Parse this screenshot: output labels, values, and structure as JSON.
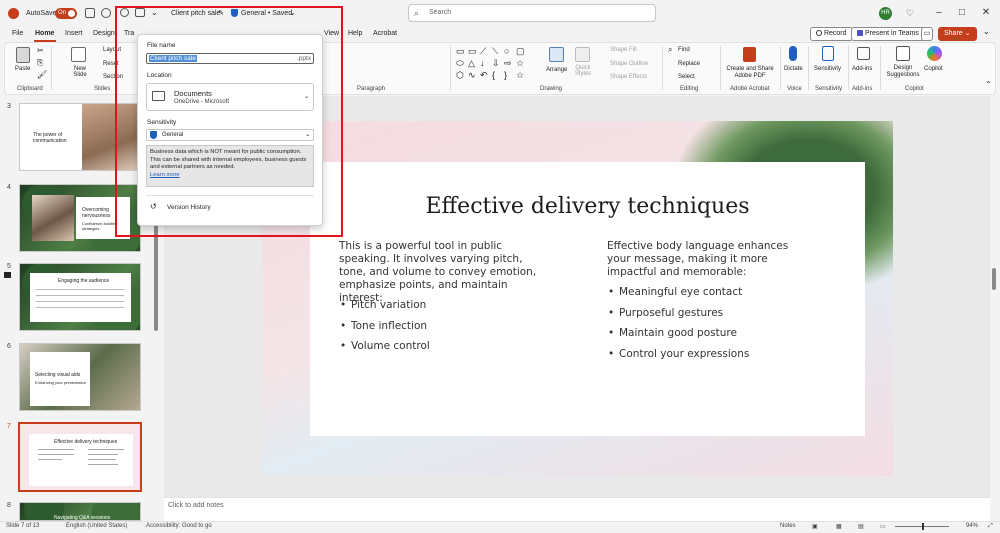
{
  "titlebar": {
    "autosave_label": "AutoSave",
    "autosave_state": "On",
    "doc_title": "Client pitch sale",
    "sensitivity": "General • Saved",
    "search_placeholder": "Search",
    "avatar_initials": "HR"
  },
  "menu": {
    "items": [
      "File",
      "Home",
      "Insert",
      "Design",
      "Tra",
      "View",
      "Help",
      "Acrobat"
    ],
    "record": "Record",
    "present_teams": "Present in Teams",
    "share": "Share"
  },
  "ribbon": {
    "paste": "Paste",
    "new_slide": "New Slide",
    "layout": "Layout",
    "reset": "Reset",
    "section": "Section",
    "arrange": "Arrange",
    "quick_styles": "Quick Styles",
    "shape_fill": "Shape Fill",
    "shape_outline": "Shape Outline",
    "shape_effects": "Shape Effects",
    "find": "Find",
    "replace": "Replace",
    "select": "Select",
    "create_share_pdf": "Create and Share Adobe PDF",
    "dictate": "Dictate",
    "sensitivity": "Sensitivity",
    "addins": "Add-ins",
    "design_suggestions": "Design Suggestions",
    "copilot": "Copilot",
    "groups": {
      "clipboard": "Clipboard",
      "slides": "Slides",
      "paragraph": "Paragraph",
      "drawing": "Drawing",
      "editing": "Editing",
      "adobe_acrobat": "Adobe Acrobat",
      "voice": "Voice",
      "sensitivity": "Sensitivity",
      "addins": "Add-ins",
      "copilot": "Copilot"
    }
  },
  "file_panel": {
    "file_name_label": "File name",
    "file_name": "Client pitch sale",
    "extension": ".pptx",
    "location_label": "Location",
    "location_name": "Documents",
    "location_sub": "OneDrive - Microsoft",
    "sensitivity_label": "Sensitivity",
    "sensitivity_value": "General",
    "sensitivity_desc": "Business data which is NOT meant for public consumption. This can be shared with internal employees, business guests and external partners as needed.",
    "learn_more": "Learn more",
    "version_history": "Version History"
  },
  "thumbnails": [
    {
      "num": "3",
      "title": "The power of communication",
      "sub": ""
    },
    {
      "num": "4",
      "title": "Overcoming nervousness",
      "sub": "Confidence-building strategies"
    },
    {
      "num": "5",
      "title": "Engaging the audience",
      "sub": ""
    },
    {
      "num": "6",
      "title": "Selecting visual aids",
      "sub": "Enhancing your presentation"
    },
    {
      "num": "7",
      "title": "Effective delivery techniques",
      "sub": ""
    },
    {
      "num": "8",
      "title": "Navigating Q&A sessions",
      "sub": ""
    }
  ],
  "slide": {
    "title": "Effective delivery techniques",
    "left_intro": "This is a powerful tool in public speaking. It involves varying pitch, tone, and volume to convey emotion, emphasize points, and maintain interest:",
    "left_bullets": [
      "Pitch variation",
      "Tone inflection",
      "Volume control"
    ],
    "right_intro": "Effective body language enhances your message, making it more impactful and memorable:",
    "right_bullets": [
      "Meaningful eye contact",
      "Purposeful gestures",
      "Maintain good posture",
      "Control your expressions"
    ]
  },
  "notes_placeholder": "Click to add notes",
  "status": {
    "slide_count": "Slide 7 of 13",
    "language": "English (United States)",
    "accessibility": "Accessibility: Good to go",
    "notes": "Notes",
    "zoom": "94%"
  },
  "colors": {
    "accent": "#c43e1c",
    "highlight": "#e0141e"
  }
}
